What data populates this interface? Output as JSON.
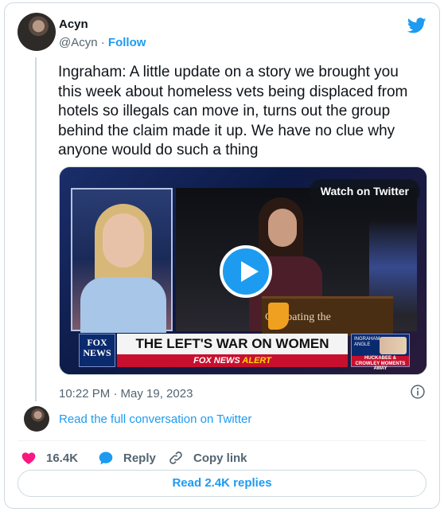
{
  "author": {
    "display_name": "Acyn",
    "handle": "@Acyn",
    "separator": "·",
    "follow_label": "Follow"
  },
  "tweet": {
    "text": "Ingraham: A little update on a story we brought you this week about homeless vets being displaced from hotels so illegals can move in, turns out the group behind the claim made it up. We have no clue why anyone would do such a thing",
    "timestamp": "10:22 PM · May 19, 2023"
  },
  "media": {
    "watch_label": "Watch on Twitter",
    "podium_text": "Combating the",
    "fox_logo_text": "FOX NEWS",
    "headline": "THE LEFT'S WAR ON WOMEN",
    "alert_prefix": "FOX NEWS",
    "alert_word": "ALERT",
    "promo_top": "INGRAHAM ANGLE",
    "promo_bottom": "HUCKABEE & CROWLEY MOMENTS AWAY"
  },
  "conversation": {
    "read_label": "Read the full conversation on Twitter"
  },
  "actions": {
    "like_count": "16.4K",
    "reply_label": "Reply",
    "copy_label": "Copy link"
  },
  "replies_button": "Read 2.4K replies",
  "colors": {
    "accent": "#1d9bf0",
    "like": "#f91880",
    "muted": "#536471",
    "text": "#0f1419"
  },
  "icons": [
    "twitter-bird-icon",
    "play-icon",
    "info-icon",
    "heart-icon",
    "reply-bubble-icon",
    "link-icon"
  ]
}
